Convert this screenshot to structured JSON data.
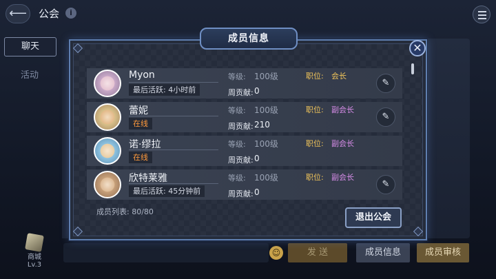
{
  "topbar": {
    "title": "公会",
    "back_icon": "back-arrow-icon",
    "info_icon": "i"
  },
  "side_tabs": {
    "chat": "聊天",
    "activity": "活动"
  },
  "shop": {
    "label": "商城",
    "level": "Lv.3"
  },
  "bottom_bar": {
    "send": "发 送",
    "members": "成员信息",
    "review": "成员审核"
  },
  "modal": {
    "title": "成员信息",
    "close_icon": "✕",
    "member_count_label": "成员列表: 80/80",
    "leave_button": "退出公会",
    "members": [
      {
        "name": "Myon",
        "status": "最后活跃: 4小时前",
        "online": false,
        "level_label": "等级:",
        "level": "100级",
        "contrib_label": "周贡献:",
        "contrib": "0",
        "pos_label": "职位:",
        "position": "会长",
        "has_edit": true
      },
      {
        "name": "蕾妮",
        "status": "在线",
        "online": true,
        "level_label": "等级:",
        "level": "100级",
        "contrib_label": "周贡献:",
        "contrib": "210",
        "pos_label": "职位:",
        "position": "副会长",
        "has_edit": true
      },
      {
        "name": "诺·缪拉",
        "status": "在线",
        "online": true,
        "level_label": "等级:",
        "level": "100级",
        "contrib_label": "周贡献:",
        "contrib": "0",
        "pos_label": "职位:",
        "position": "副会长",
        "has_edit": false
      },
      {
        "name": "欣特莱雅",
        "status": "最后活跃: 45分钟前",
        "online": false,
        "level_label": "等级:",
        "level": "100级",
        "contrib_label": "周贡献:",
        "contrib": "0",
        "pos_label": "职位:",
        "position": "副会长",
        "has_edit": true
      }
    ]
  },
  "colors": {
    "leader": "#f0c45a",
    "vice": "#d78ce8",
    "online": "#ff9a3c",
    "modal_border": "#5f7fb0"
  }
}
